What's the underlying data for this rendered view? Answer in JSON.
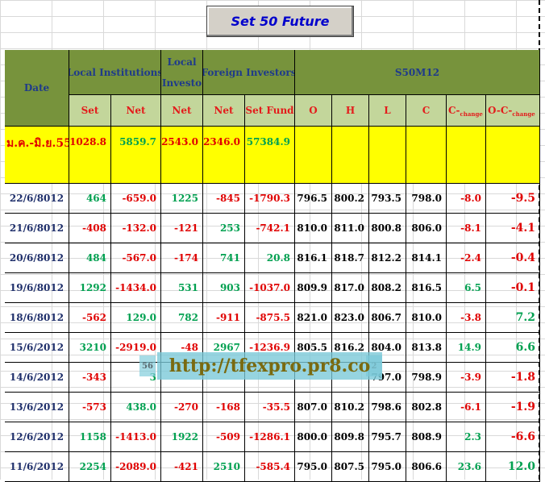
{
  "title": "Set 50  Future",
  "header": {
    "date": "Date",
    "local_institutions": "Local Institutions",
    "local_investors": "Local Investo",
    "foreign_investors": "Foreign Investors",
    "s50": "S50M12",
    "sub": [
      "Set",
      "Net",
      "Net",
      "Net",
      "Set Fund",
      "O",
      "H",
      "L",
      "C"
    ],
    "c_change": {
      "base": "C-",
      "sub": "change"
    },
    "oc_change": {
      "base": "O-C-",
      "sub": "change"
    }
  },
  "summary": {
    "label": "ม.ค.-มิ.ย.55",
    "values": [
      "1028.8",
      "5859.7",
      "-2543.0",
      "-2346.0",
      "57384.9"
    ]
  },
  "rows": [
    {
      "date": "22/6/8012",
      "vals": [
        "464",
        "-659.0",
        "1225",
        "-845",
        "-1790.3",
        "796.5",
        "800.2",
        "793.5",
        "798.0",
        "-8.0",
        "-9.5"
      ]
    },
    {
      "date": "21/6/8012",
      "vals": [
        "-408",
        "-132.0",
        "-121",
        "253",
        "-742.1",
        "810.0",
        "811.0",
        "800.8",
        "806.0",
        "-8.1",
        "-4.1"
      ]
    },
    {
      "date": "20/6/8012",
      "vals": [
        "484",
        "-567.0",
        "-174",
        "741",
        "20.8",
        "816.1",
        "818.7",
        "812.2",
        "814.1",
        "-2.4",
        "-0.4"
      ]
    },
    {
      "date": "19/6/8012",
      "vals": [
        "1292",
        "-1434.0",
        "531",
        "903",
        "-1037.0",
        "809.9",
        "817.0",
        "808.2",
        "816.5",
        "6.5",
        "-0.1"
      ]
    },
    {
      "date": "18/6/8012",
      "vals": [
        "-562",
        "129.0",
        "782",
        "-911",
        "-875.5",
        "821.0",
        "823.0",
        "806.7",
        "810.0",
        "-3.8",
        "7.2"
      ]
    },
    {
      "date": "15/6/2012",
      "vals": [
        "3210",
        "-2919.0",
        "-48",
        "2967",
        "-1236.9",
        "805.5",
        "816.2",
        "804.0",
        "813.8",
        "14.9",
        "6.6"
      ]
    },
    {
      "date": "14/6/2012",
      "vals": [
        "-343",
        "3",
        "",
        "",
        "",
        "",
        "",
        "797.0",
        "798.9",
        "-3.9",
        "-1.8"
      ]
    },
    {
      "date": "13/6/2012",
      "vals": [
        "-573",
        "438.0",
        "-270",
        "-168",
        "-35.5",
        "807.0",
        "810.2",
        "798.6",
        "802.8",
        "-6.1",
        "-1.9"
      ]
    },
    {
      "date": "12/6/2012",
      "vals": [
        "1158",
        "-1413.0",
        "1922",
        "-509",
        "-1286.1",
        "800.0",
        "809.8",
        "795.7",
        "808.9",
        "2.3",
        "-6.6"
      ]
    },
    {
      "date": "11/6/2012",
      "vals": [
        "2254",
        "-2089.0",
        "-421",
        "2510",
        "-585.4",
        "795.0",
        "807.5",
        "795.0",
        "806.6",
        "23.6",
        "12.0"
      ]
    }
  ],
  "watermark": "http://tfexpro.pr8.co",
  "watermark_side_left": "56",
  "watermark_side_right": "2",
  "colors": {
    "header": "#77933c",
    "subheader": "#c3d69b",
    "summary": "#ffff00",
    "positive": "#00a050",
    "negative": "#e00000"
  }
}
